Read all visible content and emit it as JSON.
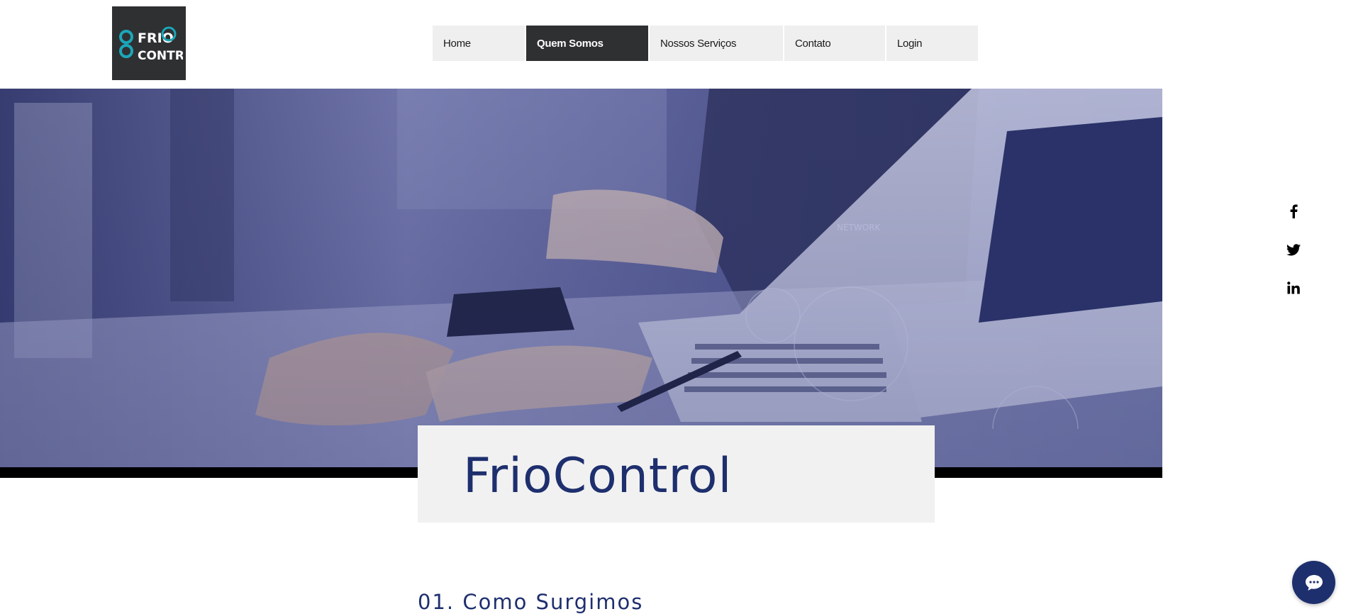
{
  "logo": {
    "line1": "FRIO",
    "line2": "CONTROL",
    "icon": "friocontrol-logo"
  },
  "nav": {
    "items": [
      {
        "label": "Home",
        "active": false
      },
      {
        "label": "Quem Somos",
        "active": true
      },
      {
        "label": "Nossos Serviços",
        "active": false
      },
      {
        "label": "Contato",
        "active": false
      },
      {
        "label": "Login",
        "active": false
      }
    ]
  },
  "hero": {
    "image": "business-laptop-photo"
  },
  "title_card": {
    "title": "FrioControl"
  },
  "section": {
    "heading": "01. Como Surgimos"
  },
  "social": [
    {
      "icon": "facebook-icon"
    },
    {
      "icon": "twitter-icon"
    },
    {
      "icon": "linkedin-icon"
    }
  ],
  "chat": {
    "icon": "chat-bubble-icon"
  },
  "colors": {
    "brand_dark": "#2f3032",
    "nav_bg": "#efefef",
    "heading_blue": "#1e2f6e",
    "logo_teal": "#1aa7b8"
  }
}
